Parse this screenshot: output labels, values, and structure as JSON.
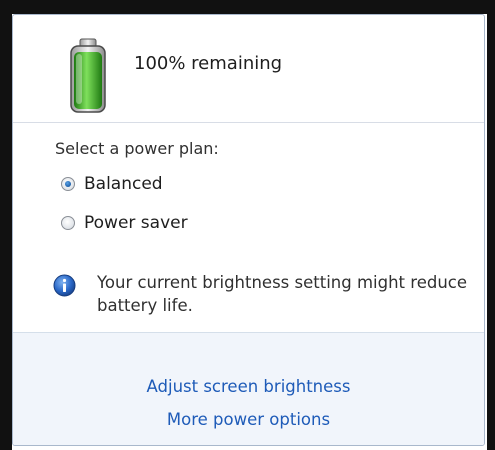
{
  "battery": {
    "status_text": "100% remaining",
    "charge_percent": 100,
    "fill_color": "#3fae2a",
    "icon": "battery-full-icon"
  },
  "power_plan": {
    "heading": "Select a power plan:",
    "options": [
      {
        "label": "Balanced",
        "selected": true
      },
      {
        "label": "Power saver",
        "selected": false
      }
    ]
  },
  "notice": {
    "icon": "info-icon",
    "text": "Your current brightness setting might reduce battery life."
  },
  "footer": {
    "links": [
      {
        "label": "Adjust screen brightness"
      },
      {
        "label": "More power options"
      }
    ],
    "link_color": "#1e5bb8",
    "background": "#f1f5fb"
  }
}
